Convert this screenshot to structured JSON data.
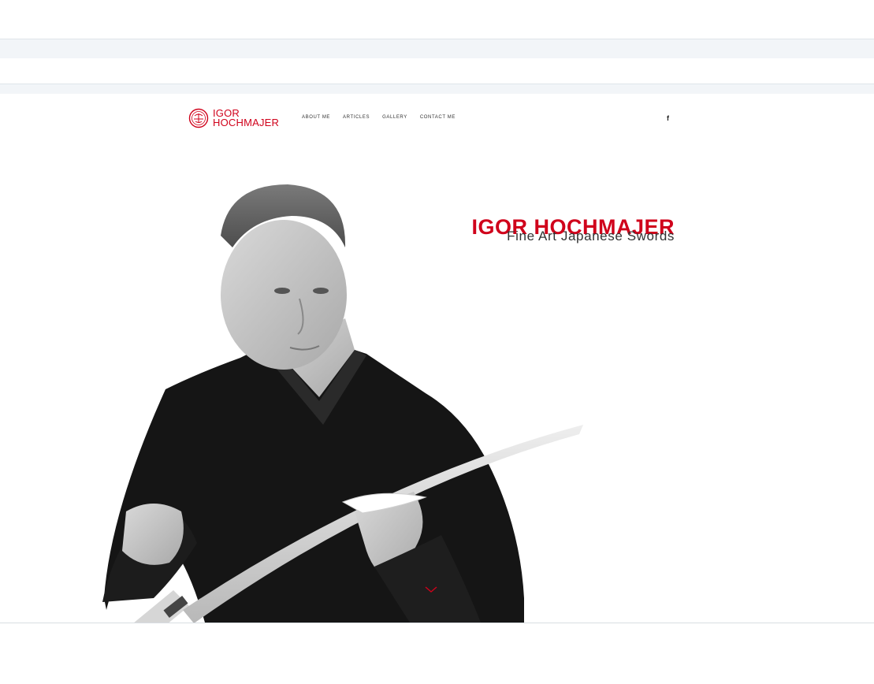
{
  "site": {
    "logo": {
      "line1": "IGOR",
      "line2": "HOCHMAJER"
    },
    "nav": [
      {
        "label": "ABOUT ME"
      },
      {
        "label": "ARTICLES"
      },
      {
        "label": "GALLERY"
      },
      {
        "label": "CONTACT ME"
      }
    ],
    "social": {
      "facebook": "f"
    }
  },
  "hero": {
    "title": "IGOR HOCHMAJER",
    "subtitle": "Fine Art Japanese Swords",
    "scroll_icon": "chevron-down-icon"
  },
  "colors": {
    "brand": "#d0021b",
    "text": "#333333",
    "band": "#f2f5f8"
  }
}
